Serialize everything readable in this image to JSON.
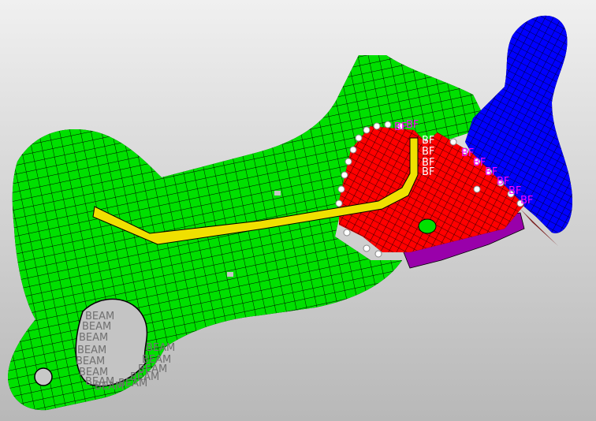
{
  "viewport": {
    "background_top": "#f0f0f0",
    "background_bottom": "#b8b8b8"
  },
  "parts": [
    {
      "name": "bracket-body",
      "color": "#00e000"
    },
    {
      "name": "blue-plate",
      "color": "#0000ff"
    },
    {
      "name": "red-bracket",
      "color": "#ff0000"
    },
    {
      "name": "purple-flange",
      "color": "#9900aa"
    },
    {
      "name": "yellow-beam",
      "color": "#f0e000"
    }
  ],
  "labels": {
    "beam": "BEAM",
    "beam_label_color": "#707070",
    "rigid_short": "BF",
    "rigid_label_color": "#ff00ff",
    "rigid_label_color_alt": "#ffffff"
  }
}
